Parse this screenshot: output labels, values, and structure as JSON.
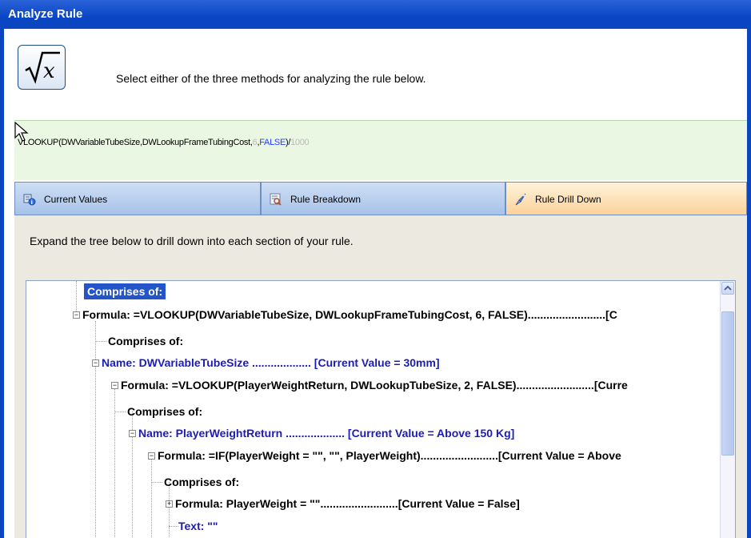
{
  "window": {
    "title": "Analyze Rule"
  },
  "header": {
    "icon": "square-root-x-icon",
    "instruction": "Select either of the three methods for analyzing the rule below."
  },
  "formula": {
    "part1": "VLOOKUP(DWVariableTubeSize,DWLookupFrameTubingCost,",
    "arg_number": "6",
    "comma": ",",
    "arg_bool": "FALSE",
    "close": ")/",
    "divisor": "1000"
  },
  "tabs": [
    {
      "label": "Current Values",
      "icon": "current-values-icon",
      "active": false
    },
    {
      "label": "Rule Breakdown",
      "icon": "rule-breakdown-icon",
      "active": false
    },
    {
      "label": "Rule Drill Down",
      "icon": "rule-drill-down-icon",
      "active": true
    }
  ],
  "drilldown": {
    "instruction": "Expand the tree below to drill down into each section of your rule.",
    "tree": [
      {
        "text": "Comprises of:",
        "style": "selected"
      },
      {
        "text": "Formula:  =VLOOKUP(DWVariableTubeSize, DWLookupFrameTubingCost, 6, FALSE).........................[C",
        "style": "black",
        "expander": "minus"
      },
      {
        "text": "Comprises of:",
        "style": "black"
      },
      {
        "text": "Name:  DWVariableTubeSize ................... [Current Value = 30mm]",
        "style": "blue",
        "expander": "minus"
      },
      {
        "text": "Formula:  =VLOOKUP(PlayerWeightReturn, DWLookupTubeSize, 2, FALSE).........................[Curre",
        "style": "black",
        "expander": "minus"
      },
      {
        "text": "Comprises of:",
        "style": "black"
      },
      {
        "text": "Name:  PlayerWeightReturn ................... [Current Value = Above 150 Kg]",
        "style": "blue",
        "expander": "minus"
      },
      {
        "text": "Formula:  =IF(PlayerWeight = \"\", \"\", PlayerWeight).........................[Current Value = Above",
        "style": "black",
        "expander": "minus"
      },
      {
        "text": "Comprises of:",
        "style": "black"
      },
      {
        "text": "Formula:  PlayerWeight = \"\".........................[Current Value = False]",
        "style": "black",
        "expander": "plus"
      },
      {
        "text": "Text:  \"\"",
        "style": "blue"
      }
    ]
  },
  "colors": {
    "title_bar": "#0b45bf",
    "formula_bg": "#eaf7e3",
    "active_tab": "#fbd29a",
    "inactive_tab": "#a6c2ea",
    "tree_blue": "#1c1cb8",
    "selection": "#2355c8"
  }
}
